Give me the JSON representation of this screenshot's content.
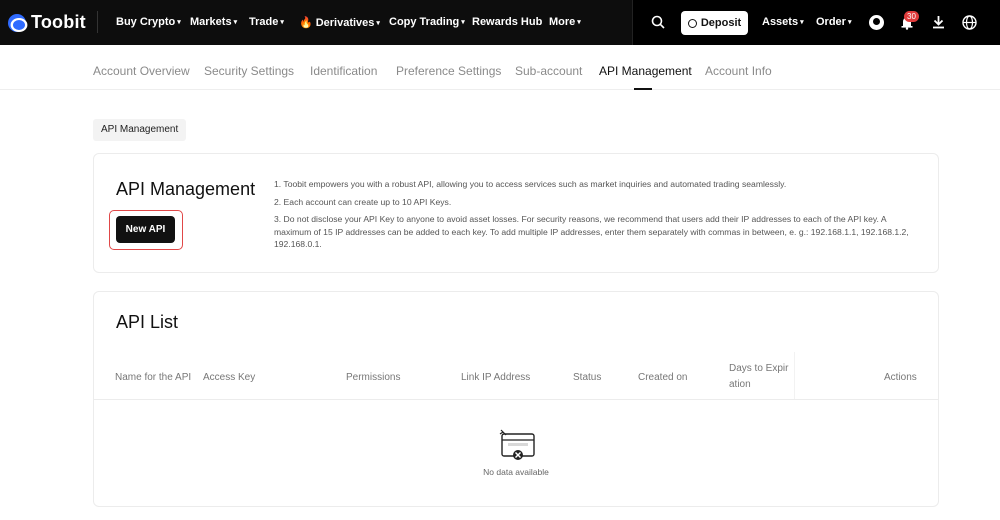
{
  "brand": {
    "name": "Toobit"
  },
  "topnav": {
    "items": [
      {
        "label": "Buy Crypto",
        "has_caret": true
      },
      {
        "label": "Markets",
        "has_caret": true
      },
      {
        "label": "Trade",
        "has_caret": true
      },
      {
        "label": "Derivatives",
        "has_caret": true,
        "icon": "fire-icon"
      },
      {
        "label": "Copy Trading",
        "has_caret": true
      },
      {
        "label": "Rewards Hub",
        "has_caret": false
      },
      {
        "label": "More",
        "has_caret": true
      }
    ],
    "deposit_label": "Deposit",
    "assets_label": "Assets",
    "order_label": "Order",
    "notification_count": "30",
    "caret": "▾"
  },
  "subnav": {
    "tabs": [
      {
        "label": "Account Overview",
        "active": false
      },
      {
        "label": "Security Settings",
        "active": false
      },
      {
        "label": "Identification",
        "active": false
      },
      {
        "label": "Preference Settings",
        "active": false
      },
      {
        "label": "Sub-account",
        "active": false
      },
      {
        "label": "API Management",
        "active": true
      },
      {
        "label": "Account Info",
        "active": false
      }
    ]
  },
  "breadcrumb": "API Management",
  "api_card": {
    "title": "API Management",
    "new_api_label": "New API",
    "notes": [
      "1. Toobit empowers you with a robust API, allowing you to access services such as market inquiries and automated trading seamlessly.",
      "2. Each account can create up to 10 API Keys.",
      "3. Do not disclose your API Key to anyone to avoid asset losses. For security reasons, we recommend that users add their IP addresses to each of the API key. A maximum of 15 IP addresses can be added to each key. To add multiple IP addresses, enter them separately with commas in between, e. g.:  192.168.1.1, 192.168.1.2, 192.168.0.1."
    ]
  },
  "api_list": {
    "title": "API List",
    "columns": [
      "Name for the API",
      "Access Key",
      "Permissions",
      "Link IP Address",
      "Status",
      "Created on",
      "Days to Expiration",
      "Actions"
    ],
    "days_col_line1": "Days to Expir",
    "days_col_line2": "ation",
    "rows": [],
    "empty_text": "No data available"
  },
  "colors": {
    "topnav_bg": "#0d0d0d",
    "brand_blue": "#2f6bff",
    "highlight_red": "#e04848",
    "badge_red": "#e03b3b"
  }
}
